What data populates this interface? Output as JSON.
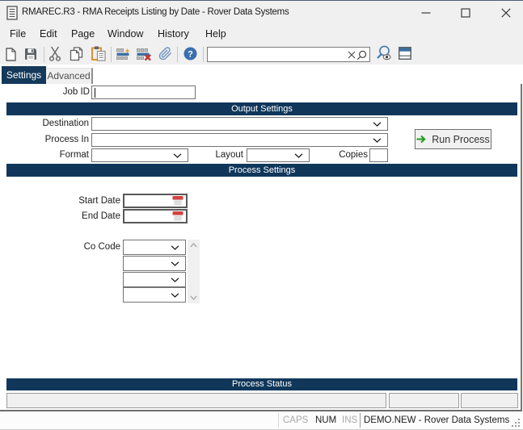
{
  "window": {
    "title": "RMAREC.R3 - RMA Receipts Listing by Date - Rover Data Systems",
    "controls": {
      "minimize": "minimize",
      "maximize": "maximize",
      "close": "close"
    }
  },
  "menu": {
    "items": [
      "File",
      "Edit",
      "Page",
      "Window",
      "History",
      "Help"
    ]
  },
  "toolbar": {
    "icons": [
      "new-document",
      "save",
      "cut",
      "copy",
      "paste",
      "add-row",
      "delete-row",
      "attach",
      "help",
      "clear-search",
      "search",
      "preview",
      "browse-layout"
    ],
    "search": {
      "value": "",
      "placeholder": ""
    }
  },
  "tabs": [
    {
      "label": "Settings",
      "active": true
    },
    {
      "label": "Advanced",
      "active": false
    }
  ],
  "form": {
    "job_id": {
      "label": "Job ID",
      "value": ""
    },
    "sections": {
      "output": "Output Settings",
      "process": "Process Settings",
      "status": "Process Status"
    },
    "destination": {
      "label": "Destination",
      "value": ""
    },
    "process_in": {
      "label": "Process In",
      "value": ""
    },
    "format": {
      "label": "Format",
      "value": ""
    },
    "layout": {
      "label": "Layout",
      "value": ""
    },
    "copies": {
      "label": "Copies",
      "value": ""
    },
    "run_button": {
      "label": "Run Process"
    },
    "start_date": {
      "label": "Start Date",
      "value": ""
    },
    "end_date": {
      "label": "End Date",
      "value": ""
    },
    "co_code": {
      "label": "Co Code",
      "values": [
        "",
        "",
        "",
        ""
      ]
    },
    "process_status": {
      "fields": [
        "",
        "",
        ""
      ]
    }
  },
  "status_bar": {
    "caps": "CAPS",
    "num": "NUM",
    "ins": "INS",
    "message": "DEMO.NEW - Rover Data Systems"
  },
  "colors": {
    "navy_bar": "#10375a",
    "navy_tab": "#14395a",
    "chrome_bg": "#f0f0f0",
    "accent_line": "#4f5e76",
    "blue_icon": "#3a6fa5",
    "help_blue": "#3b6eae",
    "orange_icon": "#e9a13b",
    "red_icon": "#c23232",
    "green_arrow": "#1f9d1f",
    "calendar_red": "#d64040"
  }
}
